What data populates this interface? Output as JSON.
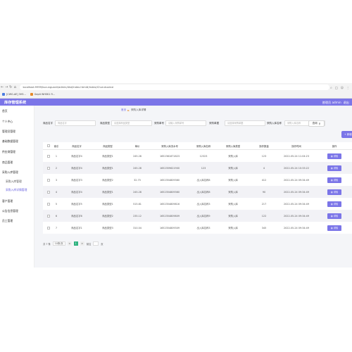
{
  "browser": {
    "nav_icons": [
      "←",
      "→",
      "↻",
      "⌂"
    ],
    "url": "localhost:9999/kucunguanli/admin/dist/index.html#/index/Churukuxinxi",
    "right_icons": [
      "☆",
      "□",
      "☺",
      "⋮"
    ],
    "bookmarks": [
      {
        "icon": "folder-icon",
        "label": "[CWG-AE] 3H5..."
      },
      {
        "icon": "page-icon",
        "label": "Gepit WHSK1 fl..."
      }
    ]
  },
  "app": {
    "title": "库存管理系统",
    "user_label": "普理员 admin",
    "logout_label": "退出"
  },
  "sidebar": {
    "items": [
      {
        "label": "首页",
        "sub": false,
        "active": false
      },
      {
        "label": "个人中心",
        "sub": false,
        "active": false
      },
      {
        "label": "管理员管理",
        "sub": false,
        "active": false
      },
      {
        "label": "基础数据管理",
        "sub": false,
        "active": false
      },
      {
        "label": "供应商管理",
        "sub": false,
        "active": false
      },
      {
        "label": "商品管理",
        "sub": false,
        "active": false
      },
      {
        "label": "采购入库管理",
        "sub": false,
        "active": false
      },
      {
        "label": "采购入库管理",
        "sub": true,
        "active": false
      },
      {
        "label": "采购入库详情管理",
        "sub": true,
        "active": true
      },
      {
        "label": "客户管理",
        "sub": false,
        "active": false
      },
      {
        "label": "公告信息管理",
        "sub": false,
        "active": false
      },
      {
        "label": "员工管理",
        "sub": false,
        "active": false
      }
    ]
  },
  "breadcrumb": {
    "home": "首页",
    "current": "采购入库详情"
  },
  "filters": [
    {
      "label": "商品名字",
      "placeholder": "商品名字"
    },
    {
      "label": "商品类型",
      "placeholder": "请选择商品类型"
    },
    {
      "label": "采购单号",
      "placeholder": "请输入采购单号"
    },
    {
      "label": "采购单据",
      "placeholder": "请选择采购单据"
    },
    {
      "label": "采购入库名称",
      "placeholder": "采购入库名称"
    }
  ],
  "search_label": "查询",
  "add_label": "+ 新增",
  "table": {
    "headers": [
      "索引",
      "商品名字",
      "商品类型",
      "单价",
      "采购入库流水号",
      "采购入库名称",
      "采购入库类型",
      "操作数量",
      "操作时间",
      "操作"
    ],
    "rows": [
      [
        "1",
        "商品名字4",
        "商品类型1",
        "245.28",
        "1652361871823",
        "12323",
        "采购入库",
        "123",
        "2022-05-24 11:04:23"
      ],
      [
        "2",
        "商品名字4",
        "商品类型1",
        "245.28",
        "1652359621900",
        "123",
        "采购入库",
        "4",
        "2022-05-24 10:33:22"
      ],
      [
        "3",
        "商品名字3",
        "商品类型2",
        "32.75",
        "1652354809360",
        "出入库名称8",
        "采购入库",
        "412",
        "2022-05-24 09:34:49"
      ],
      [
        "4",
        "商品名字4",
        "商品类型1",
        "245.28",
        "1652354809360",
        "出入库名称8",
        "采购入库",
        "90",
        "2022-05-24 09:34:49"
      ],
      [
        "5",
        "商品名字5",
        "商品类型1",
        "515.81",
        "1652354809816",
        "出入库名称3",
        "采购入库",
        "217",
        "2022-05-24 09:34:49"
      ],
      [
        "6",
        "商品名字6",
        "商品类型2",
        "235.12",
        "1652354809809",
        "出入库名称9",
        "采购入库",
        "122",
        "2022-05-24 09:34:49"
      ],
      [
        "7",
        "商品名字1",
        "商品类型3",
        "310.04",
        "1652354809309",
        "出入库名称3",
        "采购入库",
        "345",
        "2022-05-24 09:34:49"
      ]
    ],
    "op_label": "详情",
    "op_icon": "document-icon"
  },
  "pager": {
    "total": "共 7 条",
    "page_size": "10条/页",
    "prev": "<",
    "current": "1",
    "next": ">",
    "goto": "前往",
    "suffix": "页"
  },
  "colors": {
    "accent": "#7b75e8",
    "page_active": "#2fb380"
  }
}
